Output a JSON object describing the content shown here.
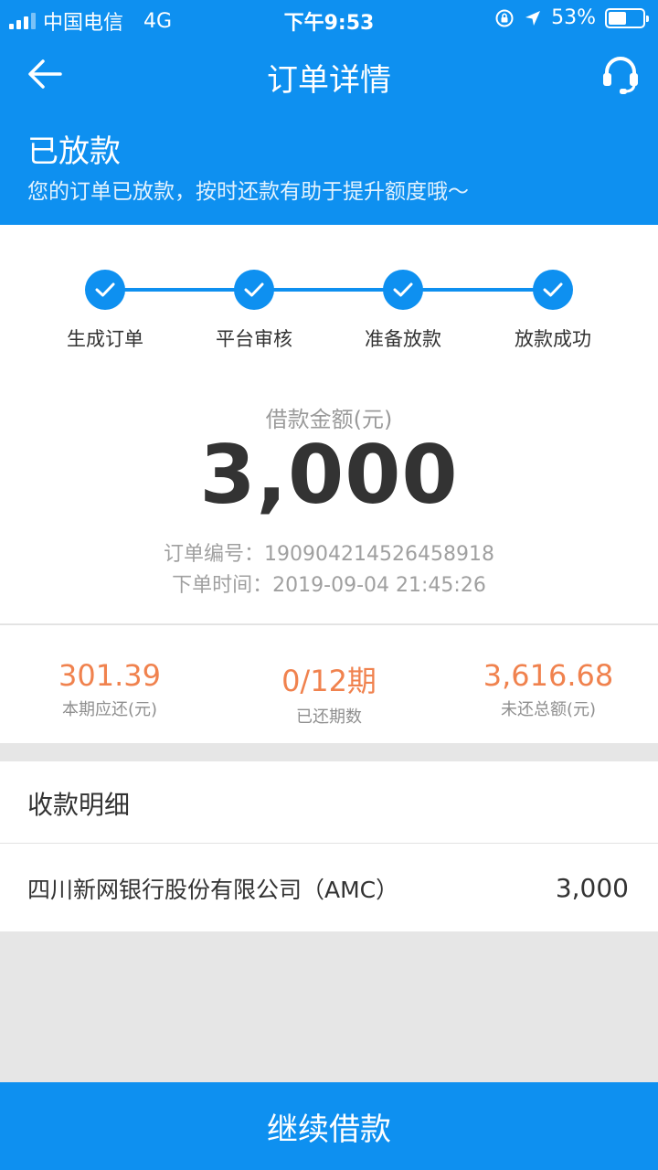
{
  "status_bar": {
    "carrier": "中国电信",
    "network": "4G",
    "time": "下午9:53",
    "battery": "53%",
    "battery_level": 0.53
  },
  "nav": {
    "title": "订单详情",
    "back_icon": "arrow-left-icon",
    "service_icon": "headset-icon"
  },
  "order_status": {
    "title": "已放款",
    "description": "您的订单已放款，按时还款有助于提升额度哦～"
  },
  "steps": [
    {
      "label": "生成订单",
      "done": true
    },
    {
      "label": "平台审核",
      "done": true
    },
    {
      "label": "准备放款",
      "done": true
    },
    {
      "label": "放款成功",
      "done": true
    }
  ],
  "loan": {
    "amount_label": "借款金额(元)",
    "amount": "3,000",
    "order_no_label": "订单编号：",
    "order_no": "190904214526458918",
    "order_time_label": "下单时间：",
    "order_time": "2019-09-04 21:45:26"
  },
  "summary": [
    {
      "value": "301.39",
      "label": "本期应还(元)"
    },
    {
      "value": "0/12期",
      "label": "已还期数"
    },
    {
      "value": "3,616.68",
      "label": "未还总额(元)"
    }
  ],
  "receipt": {
    "title": "收款明细",
    "payee": "四川新网银行股份有限公司（AMC）",
    "amount": "3,000"
  },
  "footer": {
    "button_label": "继续借款"
  },
  "colors": {
    "primary": "#0e90f0",
    "accent_orange": "#f0824e"
  }
}
